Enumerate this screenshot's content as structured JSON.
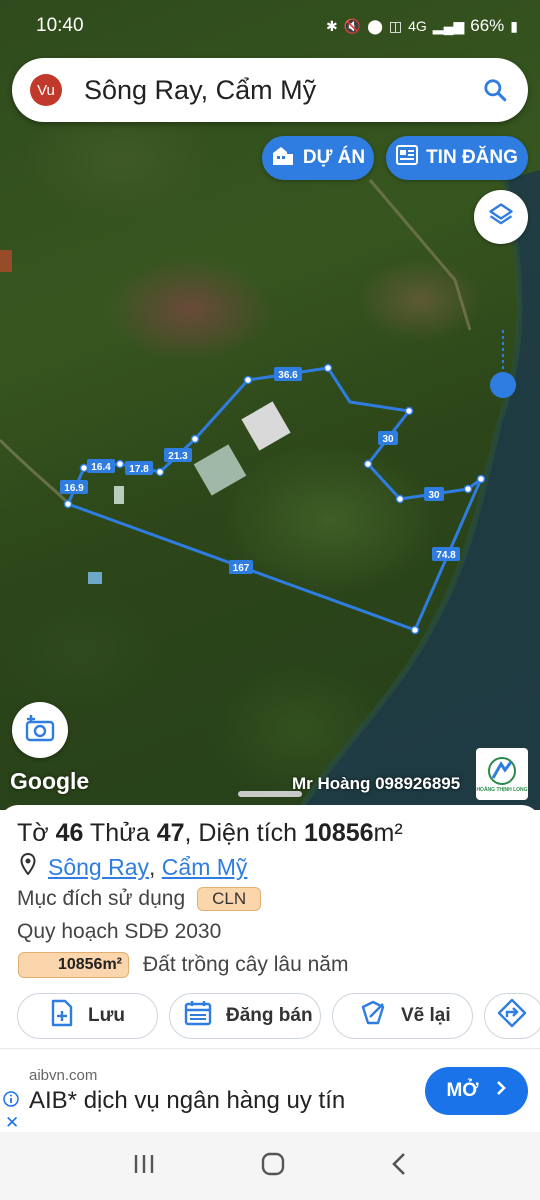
{
  "status_bar": {
    "time": "10:40",
    "battery": "66%",
    "network": "4G"
  },
  "search": {
    "avatar_initials": "Vu",
    "query": "Sông Ray, Cẩm Mỹ"
  },
  "map_buttons": {
    "du_an": "DỰ ÁN",
    "tin_dang": "TIN ĐĂNG"
  },
  "map": {
    "google_logo": "Google",
    "watermark": "Mr Hoàng 098926895",
    "corner_logo_text": "HOÀNG THỊNH LONG",
    "boundary_color": "#2f7de1",
    "segments": [
      "36.6",
      "30",
      "30",
      "74.8",
      "167",
      "16.9",
      "16.4",
      "17.8",
      "21.3"
    ]
  },
  "sheet": {
    "title_prefix": "Tờ ",
    "sheet_no": "46",
    "title_mid": " Thửa ",
    "parcel_no": "47",
    "title_area_label": ", Diện tích ",
    "area_value": "10856",
    "area_unit": "m²",
    "ward": "Sông Ray",
    "district": "Cẩm Mỹ",
    "purpose_label": "Mục đích sử dụng",
    "purpose_code": "CLN",
    "plan_label": "Quy hoạch SDĐ 2030",
    "plan_area": "10856m²",
    "plan_desc": "Đất trồng cây lâu năm",
    "accent_color": "#fbd6ad"
  },
  "actions": {
    "save": "Lưu",
    "post_sale": "Đăng bán",
    "redraw": "Vẽ lại"
  },
  "ad": {
    "domain": "aibvn.com",
    "title": "AIB* dịch vụ ngân hàng uy tín",
    "cta": "MỞ",
    "cta_color": "#1a73e8"
  }
}
